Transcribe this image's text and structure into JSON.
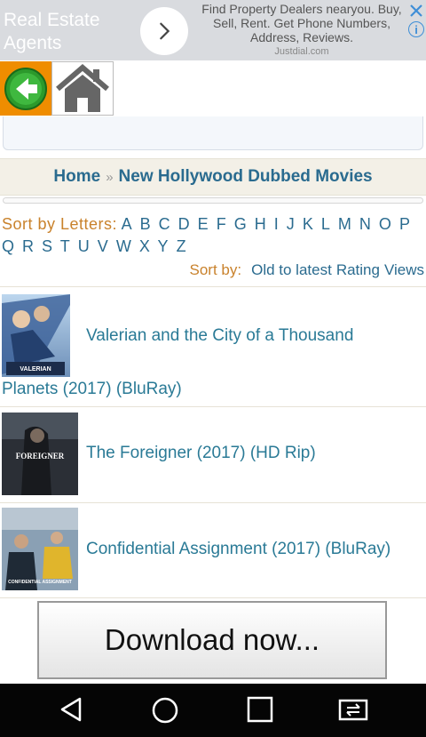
{
  "ad": {
    "title": "Real Estate Agents",
    "description": "Find Property Dealers nearyou. Buy, Sell, Rent. Get Phone Numbers, Address, Reviews.",
    "source": "Justdial.com",
    "info_label": "i"
  },
  "breadcrumb": {
    "home": "Home",
    "separator": "»",
    "current": "New Hollywood Dubbed Movies"
  },
  "sort_letters": {
    "label": "Sort by Letters:",
    "letters": [
      "A",
      "B",
      "C",
      "D",
      "E",
      "F",
      "G",
      "H",
      "I",
      "J",
      "K",
      "L",
      "M",
      "N",
      "O",
      "P",
      "Q",
      "R",
      "S",
      "T",
      "U",
      "V",
      "W",
      "X",
      "Y",
      "Z"
    ]
  },
  "sort_by": {
    "label": "Sort by:",
    "options": [
      "Old to latest",
      "Rating",
      "Views"
    ]
  },
  "movies": [
    {
      "title_line1": "Valerian and the City of a Thousand",
      "title_line2": "Planets (2017) (BluRay)",
      "poster_text": "VALERIAN"
    },
    {
      "title": "The Foreigner (2017) (HD Rip)",
      "poster_text": "FOREIGNER"
    },
    {
      "title": "Confidential Assignment (2017) (BluRay)",
      "poster_text": "CONFIDENTIAL ASSIGNMENT"
    }
  ],
  "download_button": "Download now...",
  "colors": {
    "link": "#2a6b8f",
    "accent_orange": "#c9822c",
    "back_button": "#ef8d00"
  }
}
